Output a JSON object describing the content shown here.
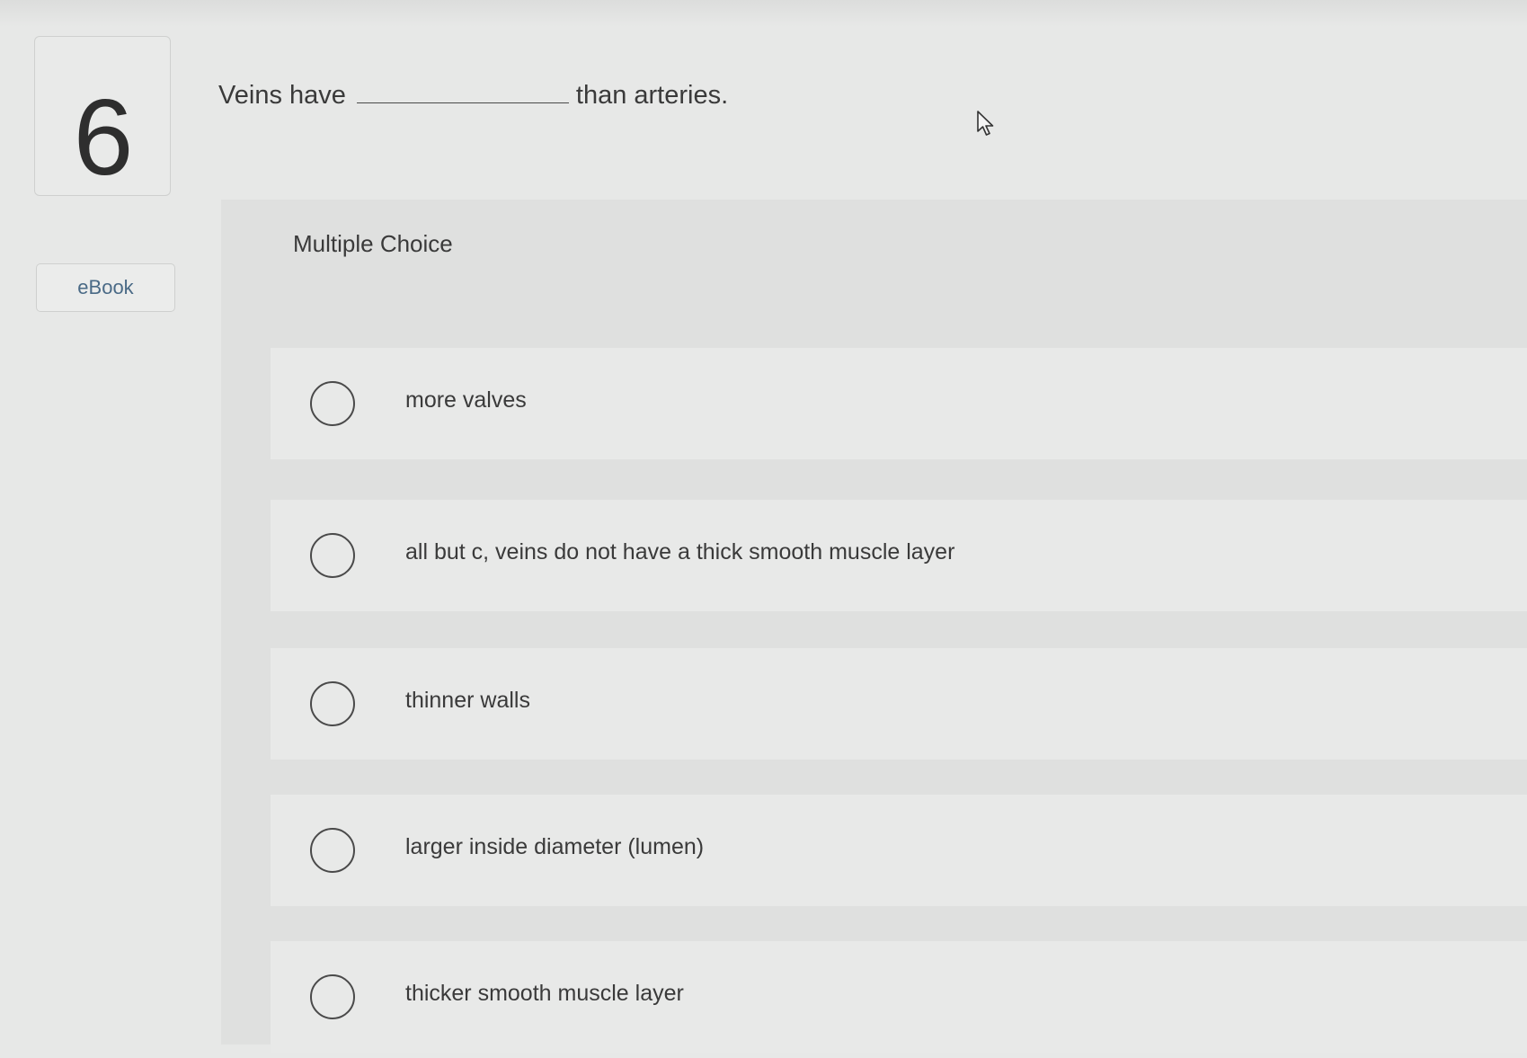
{
  "question": {
    "number": "6",
    "text_before": "Veins have",
    "text_after": "than arteries."
  },
  "sidebar": {
    "ebook_label": "eBook"
  },
  "answer_area": {
    "type_label": "Multiple Choice",
    "choices": [
      {
        "label": "more valves",
        "selected": false
      },
      {
        "label": "all but c, veins do not have a thick smooth muscle layer",
        "selected": false
      },
      {
        "label": "thinner walls",
        "selected": false
      },
      {
        "label": "larger inside diameter (lumen)",
        "selected": false
      },
      {
        "label": "thicker smooth muscle layer",
        "selected": false
      }
    ]
  },
  "icons": {
    "cursor": "mouse-pointer-icon",
    "radio": "radio-button-icon"
  },
  "colors": {
    "background": "#e7e8e7",
    "panel": "#dfe0df",
    "choice_row": "#e8e9e8",
    "link": "#4a6a86",
    "text": "#3a3a3a"
  }
}
